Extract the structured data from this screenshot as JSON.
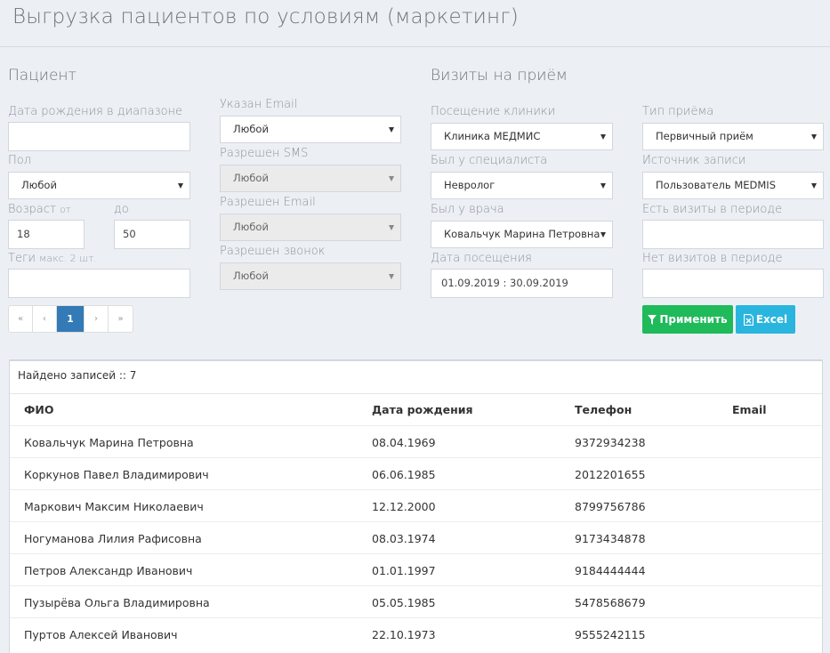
{
  "page_title": "Выгрузка пациентов по условиям (маркетинг)",
  "patient": {
    "title": "Пациент",
    "birth_range_label": "Дата рождения в диапазоне",
    "birth_range_value": "",
    "gender_label": "Пол",
    "gender_value": "Любой",
    "age_label": "Возраст",
    "age_from_label": "от",
    "age_to_label": "до",
    "age_from_value": "18",
    "age_to_value": "50",
    "tags_label": "Теги",
    "tags_hint": "макс. 2 шт.",
    "tags_value": "",
    "email_set_label": "Указан Email",
    "email_set_value": "Любой",
    "sms_allowed_label": "Разрешен SMS",
    "sms_allowed_value": "Любой",
    "email_allowed_label": "Разрешен Email",
    "email_allowed_value": "Любой",
    "call_allowed_label": "Разрешен звонок",
    "call_allowed_value": "Любой"
  },
  "pagination": {
    "first": "«",
    "prev": "‹",
    "current": "1",
    "next": "›",
    "last": "»"
  },
  "visits": {
    "title": "Визиты на приём",
    "clinic_label": "Посещение клиники",
    "clinic_value": "Клиника МЕДМИС",
    "specialist_label": "Был у специалиста",
    "specialist_value": "Невролог",
    "doctor_label": "Был у врача",
    "doctor_value": "Ковальчук Марина Петровна",
    "visit_date_label": "Дата посещения",
    "visit_date_value": "01.09.2019  :  30.09.2019",
    "type_label": "Тип приёма",
    "type_value": "Первичный приём",
    "source_label": "Источник записи",
    "source_value": "Пользователь MEDMIS",
    "has_visits_label": "Есть визиты в периоде",
    "has_visits_value": "",
    "no_visits_label": "Нет визитов в периоде",
    "no_visits_value": ""
  },
  "buttons": {
    "apply": "Применить",
    "excel": "Excel"
  },
  "results": {
    "found_text": "Найдено записей :: 7",
    "columns": [
      "ФИО",
      "Дата рождения",
      "Телефон",
      "Email"
    ],
    "rows": [
      {
        "name": "Ковальчук Марина Петровна",
        "birth": "08.04.1969",
        "phone": "9372934238",
        "email": ""
      },
      {
        "name": "Коркунов Павел Владимирович",
        "birth": "06.06.1985",
        "phone": "2012201655",
        "email": ""
      },
      {
        "name": "Маркович Максим Николаевич",
        "birth": "12.12.2000",
        "phone": "8799756786",
        "email": ""
      },
      {
        "name": "Ногуманова Лилия Рафисовна",
        "birth": "08.03.1974",
        "phone": "9173434878",
        "email": ""
      },
      {
        "name": "Петров Александр Иванович",
        "birth": "01.01.1997",
        "phone": "9184444444",
        "email": ""
      },
      {
        "name": "Пузырёва Ольга Владимировна",
        "birth": "05.05.1985",
        "phone": "5478568679",
        "email": ""
      },
      {
        "name": "Пуртов Алексей Иванович",
        "birth": "22.10.1973",
        "phone": "9555242115",
        "email": ""
      }
    ]
  },
  "colors": {
    "apply": "#1fba5a",
    "excel": "#2ab5de",
    "page_active": "#337ab7",
    "background": "#ecf0f5"
  },
  "icons": {
    "apply": "filter-icon",
    "excel": "excel-file-icon"
  }
}
